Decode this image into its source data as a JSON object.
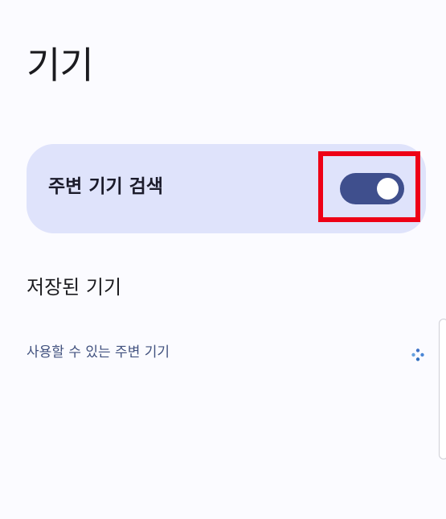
{
  "page": {
    "title": "기기"
  },
  "toggle_card": {
    "label": "주변 기기 검색",
    "switch_on": true
  },
  "saved_devices": {
    "heading": "저장된 기기"
  },
  "nearby_devices": {
    "heading": "사용할 수 있는 주변 기기",
    "status_icon": "loading-spinner-icon"
  },
  "colors": {
    "background": "#fbfbff",
    "card": "#dfe3fb",
    "switch_track": "#3f4f8d",
    "highlight": "#ee0016",
    "secondary_text": "#42527f"
  }
}
